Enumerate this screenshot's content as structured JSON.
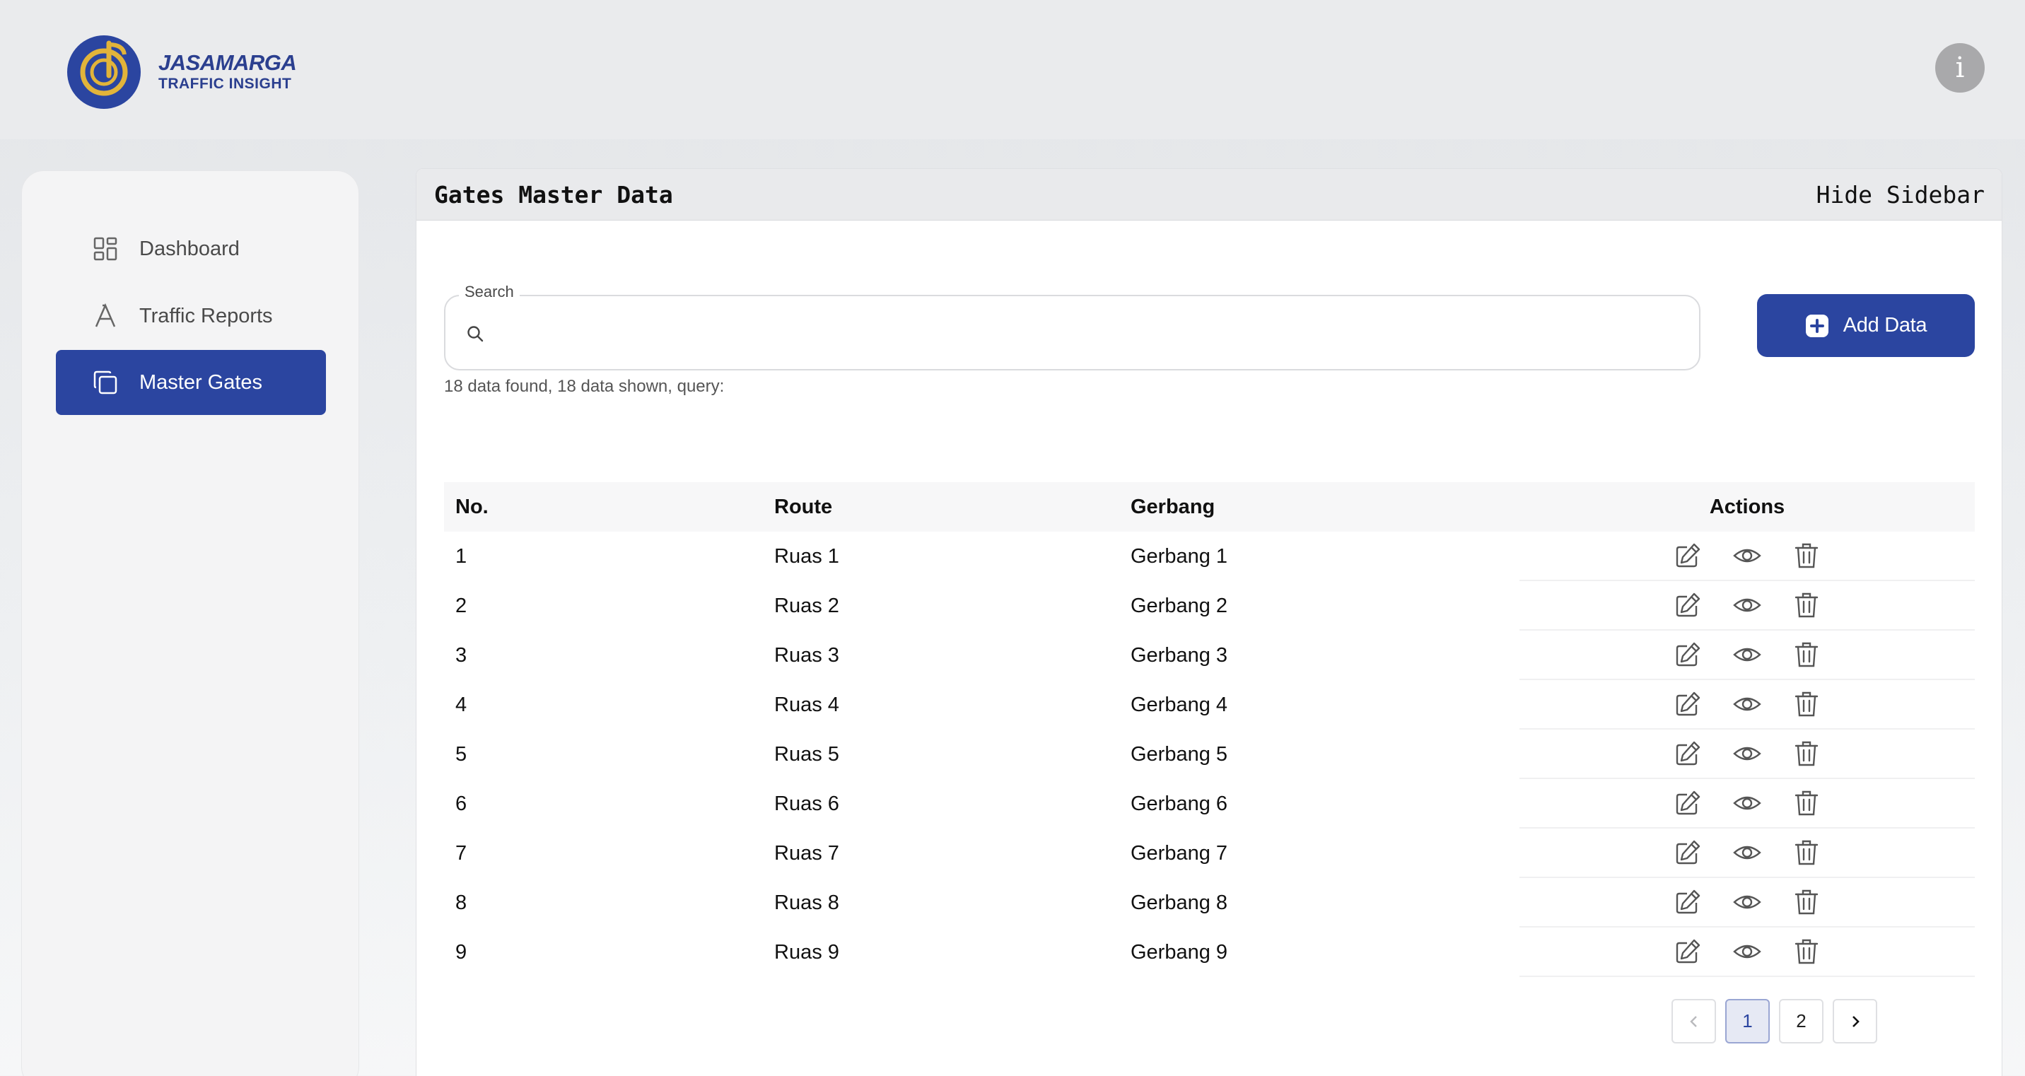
{
  "brand": {
    "line1": "JASAMARGA",
    "line2": "TRAFFIC INSIGHT",
    "accent": "#2b45a0",
    "gold": "#e2b43a"
  },
  "info_button": {
    "label": "i"
  },
  "sidebar": {
    "items": [
      {
        "label": "Dashboard",
        "icon": "grid-icon",
        "active": false
      },
      {
        "label": "Traffic Reports",
        "icon": "letter-a-icon",
        "active": false
      },
      {
        "label": "Master Gates",
        "icon": "copy-icon",
        "active": true
      }
    ]
  },
  "panel": {
    "title": "Gates Master Data",
    "hide_sidebar": "Hide Sidebar"
  },
  "search": {
    "label": "Search",
    "value": "",
    "placeholder": "",
    "result_text": "18 data found, 18 data shown, query:"
  },
  "add_button": {
    "label": "Add Data"
  },
  "table": {
    "headers": {
      "no": "No.",
      "route": "Route",
      "gate": "Gerbang",
      "actions": "Actions"
    },
    "rows": [
      {
        "no": "1",
        "route": "Ruas 1",
        "gate": "Gerbang 1"
      },
      {
        "no": "2",
        "route": "Ruas 2",
        "gate": "Gerbang 2"
      },
      {
        "no": "3",
        "route": "Ruas 3",
        "gate": "Gerbang 3"
      },
      {
        "no": "4",
        "route": "Ruas 4",
        "gate": "Gerbang 4"
      },
      {
        "no": "5",
        "route": "Ruas 5",
        "gate": "Gerbang 5"
      },
      {
        "no": "6",
        "route": "Ruas 6",
        "gate": "Gerbang 6"
      },
      {
        "no": "7",
        "route": "Ruas 7",
        "gate": "Gerbang 7"
      },
      {
        "no": "8",
        "route": "Ruas 8",
        "gate": "Gerbang 8"
      },
      {
        "no": "9",
        "route": "Ruas 9",
        "gate": "Gerbang 9"
      }
    ]
  },
  "pagination": {
    "pages": [
      "1",
      "2"
    ],
    "current": "1",
    "prev_icon": "chevron-left-icon",
    "next_icon": "chevron-right-icon"
  }
}
